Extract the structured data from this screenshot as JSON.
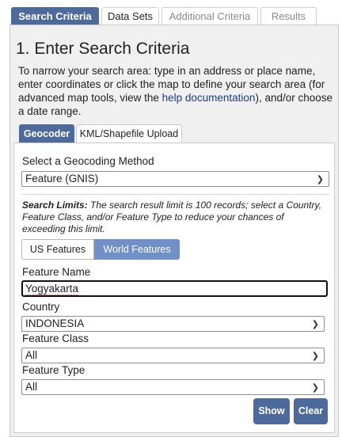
{
  "top_tabs": [
    "Search Criteria",
    "Data Sets",
    "Additional Criteria",
    "Results"
  ],
  "panel": {
    "title": "1. Enter Search Criteria",
    "intro_before": "To narrow your search area: type in an address or place name, enter coordinates or click the map to define your search area (for advanced map tools, view the ",
    "intro_link": "help documentation",
    "intro_after": "), and/or choose a date range."
  },
  "sub_tabs": [
    "Geocoder",
    "KML/Shapefile Upload"
  ],
  "geocoder": {
    "method_label": "Select a Geocoding Method",
    "method_value": "Feature (GNIS)",
    "limits_title": "Search Limits:",
    "limits_text": " The search result limit is 100 records; select a Country, Feature Class, and/or Feature Type to reduce your chances of exceeding this limit.",
    "toggle_us": "US Features",
    "toggle_world": "World Features",
    "feature_name_label": "Feature Name",
    "feature_name_value": "Yogyakarta",
    "country_label": "Country",
    "country_value": "INDONESIA",
    "feature_class_label": "Feature Class",
    "feature_class_value": "All",
    "feature_type_label": "Feature Type",
    "feature_type_value": "All",
    "show_button": "Show",
    "clear_button": "Clear"
  },
  "colors": {
    "accent": "#4d6a9c",
    "toggle_active": "#6f90c9",
    "link": "#1a3d8f"
  }
}
